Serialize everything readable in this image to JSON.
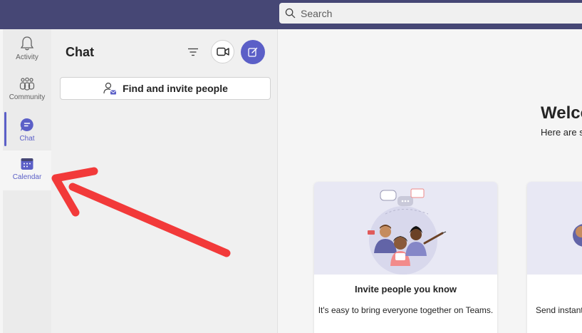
{
  "search": {
    "placeholder": "Search"
  },
  "rail": {
    "items": [
      {
        "label": "Activity",
        "icon": "bell-icon"
      },
      {
        "label": "Community",
        "icon": "community-icon"
      },
      {
        "label": "Chat",
        "icon": "chat-icon",
        "active": true
      },
      {
        "label": "Calendar",
        "icon": "calendar-icon"
      }
    ]
  },
  "chat_panel": {
    "title": "Chat",
    "invite_label": "Find and invite people"
  },
  "main": {
    "welcome_title": "Welco",
    "welcome_sub": "Here are s",
    "cards": [
      {
        "title": "Invite people you know",
        "desc": "It's easy to bring everyone together on Teams."
      },
      {
        "title": "",
        "desc": "Send instant"
      }
    ]
  },
  "colors": {
    "brand": "#5b5fc7",
    "topbar": "#464775",
    "annotation_arrow": "#f23a3a"
  }
}
